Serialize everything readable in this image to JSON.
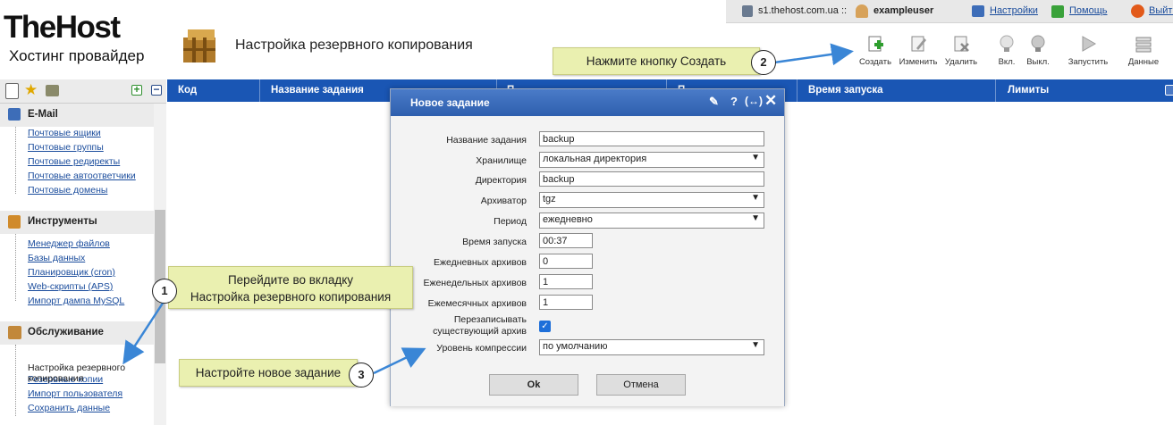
{
  "top": {
    "server": "s1.thehost.com.ua ::",
    "user": "exampleuser",
    "links": [
      "Настройки",
      "Помощь",
      "Выйти"
    ]
  },
  "logo": {
    "title": "TheHost",
    "subtitle": "Хостинг провайдер"
  },
  "page_title": "Настройка резервного копирования",
  "toolbar": [
    "Создать",
    "Изменить",
    "Удалить",
    "Вкл.",
    "Выкл.",
    "Запустить",
    "Данные"
  ],
  "sidebar": {
    "sections": [
      {
        "title": "E-Mail",
        "items": [
          "Почтовые ящики",
          "Почтовые группы",
          "Почтовые редиректы",
          "Почтовые автоответчики",
          "Почтовые домены"
        ]
      },
      {
        "title": "Инструменты",
        "items": [
          "Менеджер файлов",
          "Базы данных",
          "Планировщик (cron)",
          "Web-скрипты (APS)",
          "Импорт дампа MySQL"
        ]
      },
      {
        "title": "Обслуживание",
        "items": [
          "Резервные копии",
          "Настройка резервного\nкопирования",
          "Импорт пользователя",
          "Сохранить данные"
        ]
      }
    ]
  },
  "grid": {
    "columns": [
      "Код",
      "Название задания",
      "П",
      "П",
      "Время запуска",
      "Лимиты"
    ]
  },
  "dialog": {
    "title": "Новое задание",
    "fields": {
      "name_label": "Название задания",
      "name_value": "backup",
      "storage_label": "Хранилище",
      "storage_value": "локальная директория",
      "dir_label": "Директория",
      "dir_value": "backup",
      "arch_label": "Архиватор",
      "arch_value": "tgz",
      "period_label": "Период",
      "period_value": "ежедневно",
      "time_label": "Время запуска",
      "time_value": "00:37",
      "daily_label": "Ежедневных архивов",
      "daily_value": "0",
      "weekly_label": "Еженедельных архивов",
      "weekly_value": "1",
      "monthly_label": "Ежемесячных архивов",
      "monthly_value": "1",
      "overwrite_label_1": "Перезаписывать",
      "overwrite_label_2": "существующий архив",
      "compress_label": "Уровень компрессии",
      "compress_value": "по умолчанию"
    },
    "ok": "Ok",
    "cancel": "Отмена"
  },
  "callouts": {
    "c1_line1": "Перейдите во вкладку",
    "c1_line2": "Настройка резервного копирования",
    "c2": "Нажмите кнопку Создать",
    "c3": "Настройте новое задание",
    "n1": "1",
    "n2": "2",
    "n3": "3"
  },
  "colors": {
    "grid_header": "#1a56b4",
    "dialog_header": "#3a6cbc",
    "callout": "#eaf0b0",
    "link": "#1a4c9c"
  }
}
